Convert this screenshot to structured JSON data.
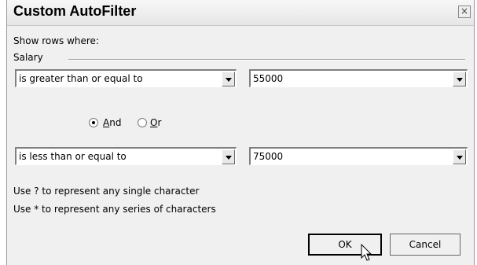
{
  "dialog": {
    "title": "Custom AutoFilter",
    "close_glyph": "×",
    "show_rows_label": "Show rows where:",
    "field_name": "Salary",
    "criteria": [
      {
        "operator": "is greater than or equal to",
        "value": "55000"
      },
      {
        "operator": "is less than or equal to",
        "value": "75000"
      }
    ],
    "logic": {
      "and_label_access": "A",
      "and_label_rest": "nd",
      "or_label_access": "O",
      "or_label_rest": "r",
      "selected": "And"
    },
    "hint_single": "Use ? to represent any single character",
    "hint_series": "Use * to represent any series of characters",
    "ok_label": "OK",
    "cancel_label": "Cancel"
  },
  "icons": {
    "close": "close-icon",
    "dropdown": "chevron-down-icon",
    "cursor": "mouse-pointer-icon"
  }
}
